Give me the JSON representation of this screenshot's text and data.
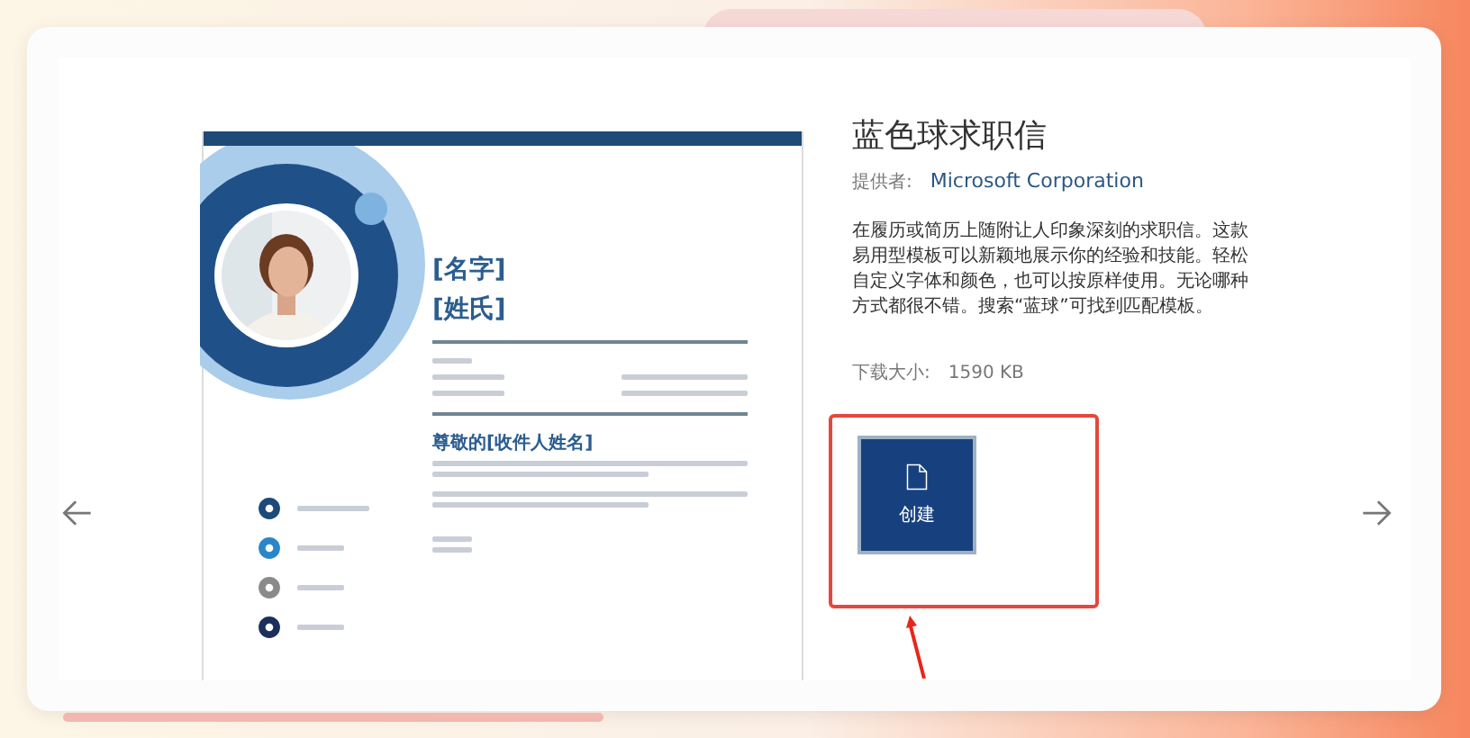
{
  "template_preview": {
    "first_name": "[名字]",
    "last_name": "[姓氏]",
    "salutation": "尊敬的[收件人姓名]"
  },
  "details": {
    "title": "蓝色球求职信",
    "provider_label": "提供者:",
    "provider": "Microsoft Corporation",
    "description": "在履历或简历上随附让人印象深刻的求职信。这款易用型模板可以新颖地展示你的经验和技能。轻松自定义字体和颜色，也可以按原样使用。无论哪种方式都很不错。搜索“蓝球”可找到匹配模板。",
    "size_label": "下载大小:",
    "size": "1590 KB"
  },
  "create_button": {
    "label": "创建"
  }
}
